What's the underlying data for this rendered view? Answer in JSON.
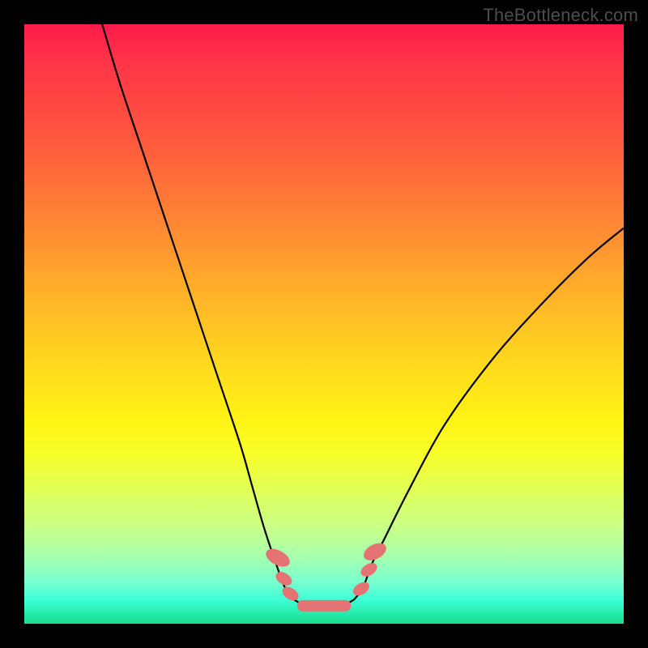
{
  "watermark": "TheBottleneck.com",
  "chart_data": {
    "type": "line",
    "title": "",
    "xlabel": "",
    "ylabel": "",
    "ylim": [
      0,
      100
    ],
    "xlim": [
      0,
      100
    ],
    "series": [
      {
        "name": "left-curve",
        "x": [
          13,
          16,
          20,
          24,
          28,
          32,
          36,
          38,
          40,
          42,
          43.5,
          45
        ],
        "y": [
          100,
          90,
          78,
          66,
          54,
          42,
          30,
          23,
          16,
          10,
          6,
          4
        ]
      },
      {
        "name": "valley",
        "x": [
          45,
          47,
          49,
          51,
          53,
          55
        ],
        "y": [
          4,
          3,
          3,
          3,
          3,
          4
        ]
      },
      {
        "name": "right-curve",
        "x": [
          55,
          56.5,
          58,
          60,
          64,
          70,
          78,
          86,
          94,
          100
        ],
        "y": [
          4,
          6,
          10,
          14,
          22,
          33,
          44,
          53,
          61,
          66
        ]
      }
    ],
    "markers": {
      "left_small": [
        {
          "x": 43.3,
          "y": 7.5
        },
        {
          "x": 44.4,
          "y": 5
        }
      ],
      "left_big": [
        {
          "x": 42.3,
          "y": 11
        }
      ],
      "right_small": [
        {
          "x": 56.2,
          "y": 5.8
        },
        {
          "x": 57.5,
          "y": 9
        }
      ],
      "right_big": [
        {
          "x": 58.5,
          "y": 12
        }
      ],
      "bottom_pill": {
        "x1": 45.5,
        "x2": 54.5,
        "y": 3
      }
    },
    "gradient_colors": {
      "top": "#ff1b4a",
      "mid": "#ffd71e",
      "bottom": "#1dd98f"
    }
  }
}
